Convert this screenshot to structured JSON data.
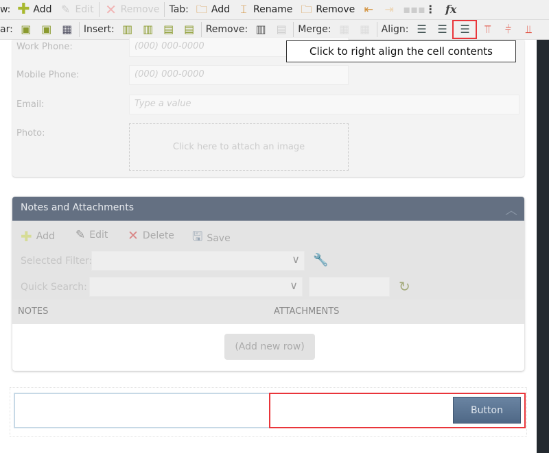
{
  "toolbar_row1": {
    "row_label": "w:",
    "add": "Add",
    "edit": "Edit",
    "remove": "Remove",
    "tab_label": "Tab:",
    "tab_add": "Add",
    "tab_rename": "Rename",
    "tab_remove": "Remove",
    "fx": "fx"
  },
  "toolbar_row2": {
    "bar_label": "ar:",
    "insert_label": "Insert:",
    "remove_label": "Remove:",
    "merge_label": "Merge:",
    "align_label": "Align:"
  },
  "tooltip": "Click to right align the cell contents",
  "form": {
    "work_phone_label": "Work Phone:",
    "work_phone_placeholder": "(000) 000-0000",
    "mobile_phone_label": "Mobile Phone:",
    "mobile_phone_placeholder": "(000) 000-0000",
    "email_label": "Email:",
    "email_placeholder": "Type a value",
    "photo_label": "Photo:",
    "photo_hint": "Click here to attach an image"
  },
  "notes": {
    "title": "Notes and Attachments",
    "add": "Add",
    "edit": "Edit",
    "delete": "Delete",
    "save": "Save",
    "selected_filter_label": "Selected Filter:",
    "quick_search_label": "Quick Search:",
    "columns": [
      "NOTES",
      "ATTACHMENTS"
    ],
    "add_row": "(Add new row)"
  },
  "bottom": {
    "button_label": "Button"
  },
  "colors": {
    "accent_header": "#647082",
    "button": "#5a7391",
    "highlight": "#e9353a"
  }
}
